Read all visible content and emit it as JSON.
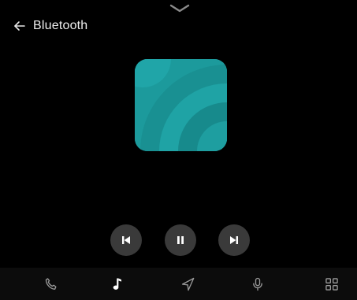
{
  "header": {
    "title": "Bluetooth",
    "back_icon": "arrow-left-icon"
  },
  "album_art": {
    "icon": "album-art",
    "colors": [
      "#1e9ea0",
      "#178a8c",
      "#23b1b1"
    ]
  },
  "player": {
    "state": "playing",
    "controls": [
      "previous-track-icon",
      "pause-icon",
      "next-track-icon"
    ]
  },
  "nav": {
    "active": "music",
    "items": [
      "phone-icon",
      "music-note-icon",
      "navigation-icon",
      "microphone-icon",
      "apps-grid-icon"
    ]
  },
  "colors": {
    "background": "#000000",
    "control_bg": "#3a3a3a",
    "accent": "#1e9ea0",
    "navbar_bg": "#0c0c0c",
    "inactive_icon": "#9a9a9a",
    "active_icon": "#ffffff"
  }
}
